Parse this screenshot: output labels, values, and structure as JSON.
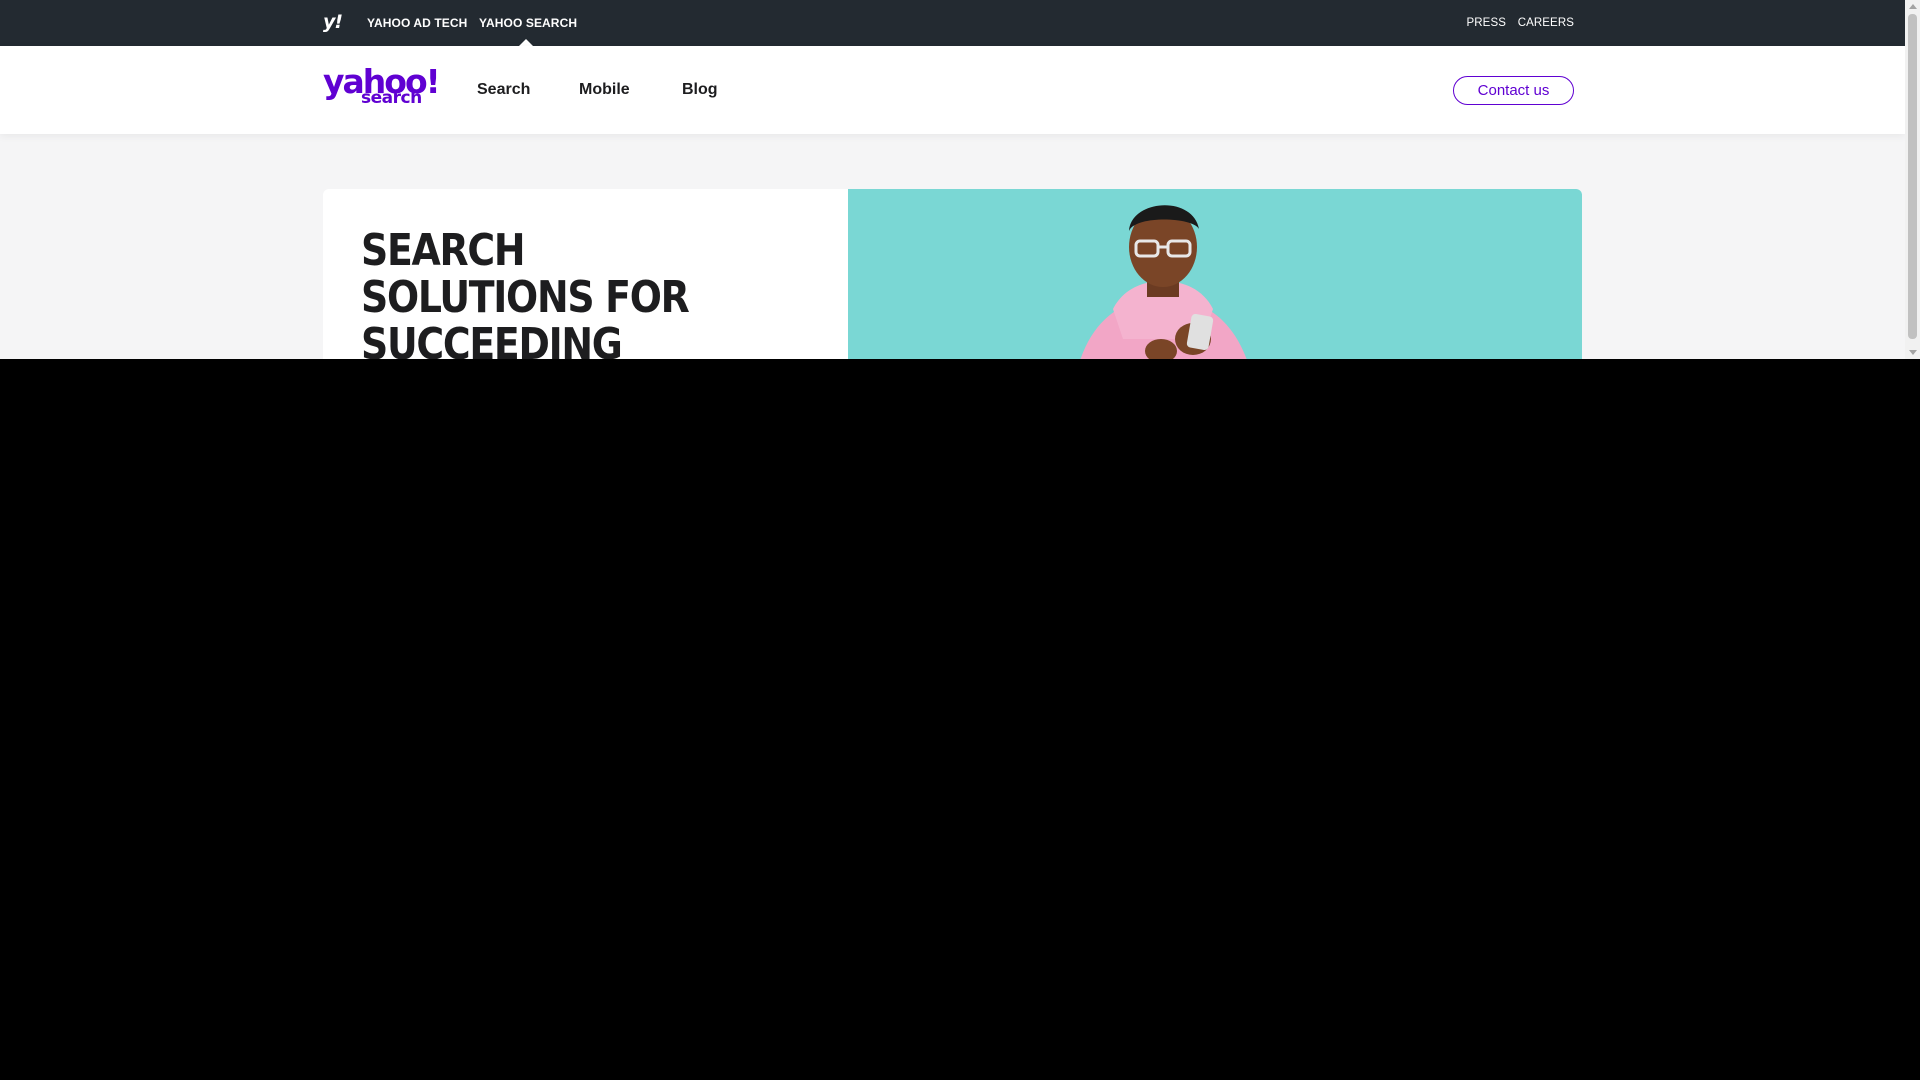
{
  "topbar": {
    "logo_text": "y!",
    "links": {
      "ad_tech": "YAHOO AD TECH",
      "search": "YAHOO SEARCH",
      "press": "PRESS",
      "careers": "CAREERS"
    }
  },
  "nav": {
    "logo_word": "yahoo!",
    "logo_sub": "search",
    "items": [
      "Search",
      "Mobile",
      "Blog"
    ],
    "contact_label": "Contact us"
  },
  "hero": {
    "headline": "SEARCH SOLUTIONS FOR SUCCEEDING TOGETHER"
  },
  "colors": {
    "brand_purple": "#6001d2",
    "topbar_bg": "#232a31",
    "hero_photo_bg": "#7ad7d4",
    "page_bg": "#f5f5f6"
  }
}
